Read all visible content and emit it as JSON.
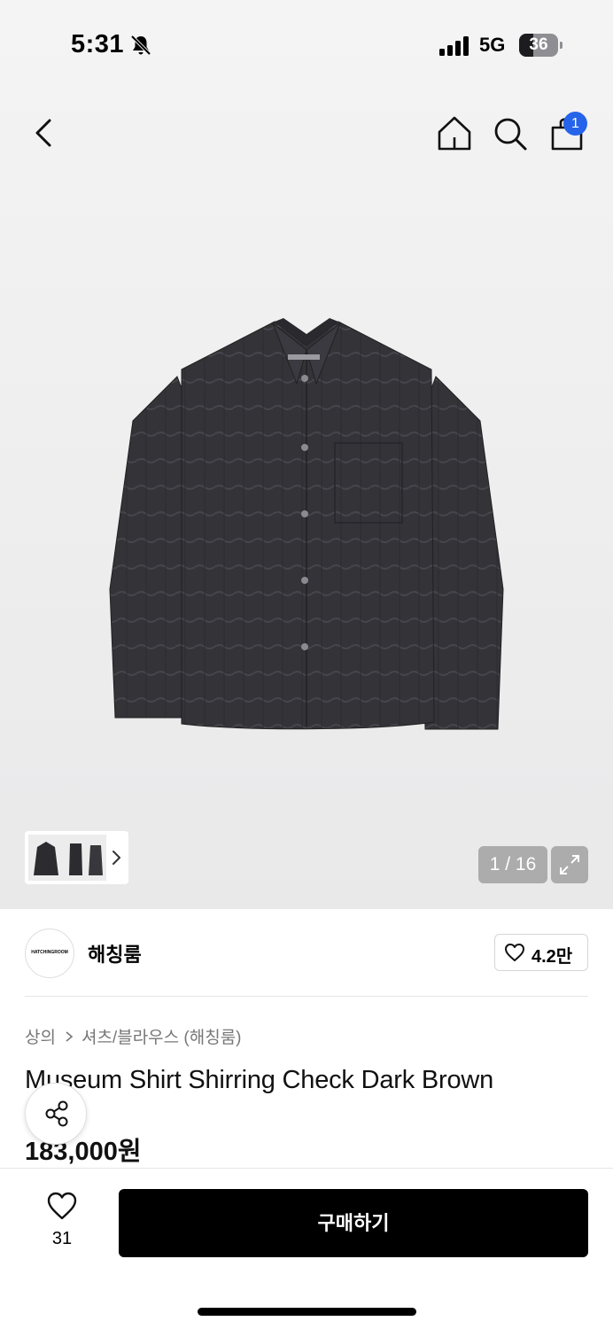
{
  "status_bar": {
    "time": "5:31",
    "network": "5G",
    "battery": "36",
    "battery_level": 0.36
  },
  "nav": {
    "back_icon": "chevron-left-icon",
    "home_icon": "home-icon",
    "search_icon": "search-icon",
    "cart_icon": "shopping-bag-icon",
    "cart_badge": "1"
  },
  "gallery": {
    "page_indicator": "1 / 16",
    "expand_icon": "expand-icon"
  },
  "brand": {
    "logo_text": "HATCHINGROOM",
    "name": "해칭룸",
    "like_count": "4.2만"
  },
  "breadcrumb": [
    "상의",
    "셔츠/블라우스 (해칭룸)"
  ],
  "product": {
    "title": "Museum Shirt Shirring Check Dark Brown",
    "price": "183,000원"
  },
  "bottom": {
    "wish_count": "31",
    "buy_label": "구매하기"
  },
  "colors": {
    "accent": "#2563eb",
    "button": "#000000"
  }
}
